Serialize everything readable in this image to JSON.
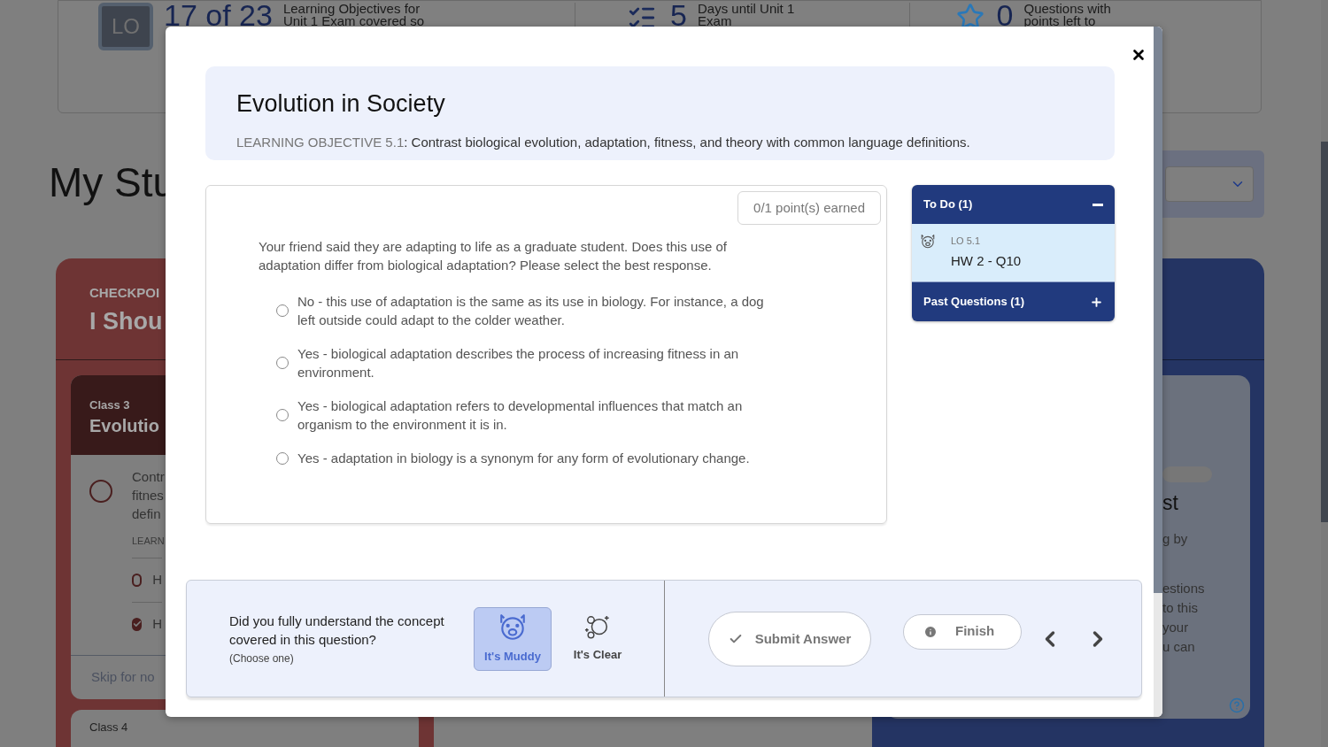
{
  "background": {
    "stats": [
      {
        "kind": "lo",
        "badge": "LO",
        "value": "17 of 23",
        "label_lines": [
          "Learning Objectives for",
          "Unit 1 Exam covered so"
        ]
      },
      {
        "kind": "days",
        "value": "5",
        "label_lines": [
          "Days until Unit 1",
          "Exam"
        ]
      },
      {
        "kind": "points",
        "value": "0",
        "label_lines": [
          "Questions with",
          "points left to"
        ]
      }
    ],
    "heading": "My Stu",
    "checkpoint_card": {
      "eyebrow": "CHECKPOI",
      "title": "I Shou",
      "class_label": "Class 3",
      "class_title": "Evolutio",
      "objective_lines": [
        "Contr",
        "fitnes",
        "defin"
      ],
      "objective_label": "LEARN",
      "items": [
        {
          "text": "H",
          "checked": false
        },
        {
          "text": "H",
          "checked": true
        }
      ],
      "skip": "Skip for no",
      "next_class": "Class 4"
    },
    "right_card": {
      "title": "st",
      "subtitle": "g by",
      "lines": [
        "estions",
        "to this",
        "your",
        "u can"
      ]
    }
  },
  "modal": {
    "title": "Evolution in Society",
    "objective_label": "LEARNING OBJECTIVE 5.1",
    "objective_text": ": Contrast biological evolution, adaptation, fitness, and theory with common language definitions.",
    "points": "0/1 point(s) earned",
    "question": "Your friend said they are adapting to life as a graduate student. Does this use of adaptation differ from biological adaptation? Please select the best response.",
    "options": [
      {
        "text": "No - this use of adaptation is the same as its use in biology. For instance, a dog left outside could adapt to the colder weather.",
        "selected": false
      },
      {
        "text": "Yes - biological adaptation describes the process of increasing fitness in an environment.",
        "selected": false
      },
      {
        "text": "Yes - biological adaptation refers to developmental influences that match an organism to the environment it is in.",
        "selected": false
      },
      {
        "text": "Yes - adaptation in biology is a synonym for any form of evolutionary change.",
        "selected": false
      }
    ],
    "panel": [
      {
        "title": "To Do (1)",
        "expanded": true,
        "items": [
          {
            "tag": "LO 5.1",
            "label": "HW 2 - Q10"
          }
        ]
      },
      {
        "title": "Past Questions (1)",
        "expanded": false
      }
    ],
    "understanding": {
      "prompt": "Did you fully understand the concept covered in this question?",
      "hint": "(Choose one)",
      "choices": [
        {
          "kind": "muddy",
          "label": "It's Muddy",
          "selected": true
        },
        {
          "kind": "clear",
          "label": "It's Clear",
          "selected": false
        }
      ]
    },
    "submit": "Submit Answer",
    "finish": "Finish"
  }
}
